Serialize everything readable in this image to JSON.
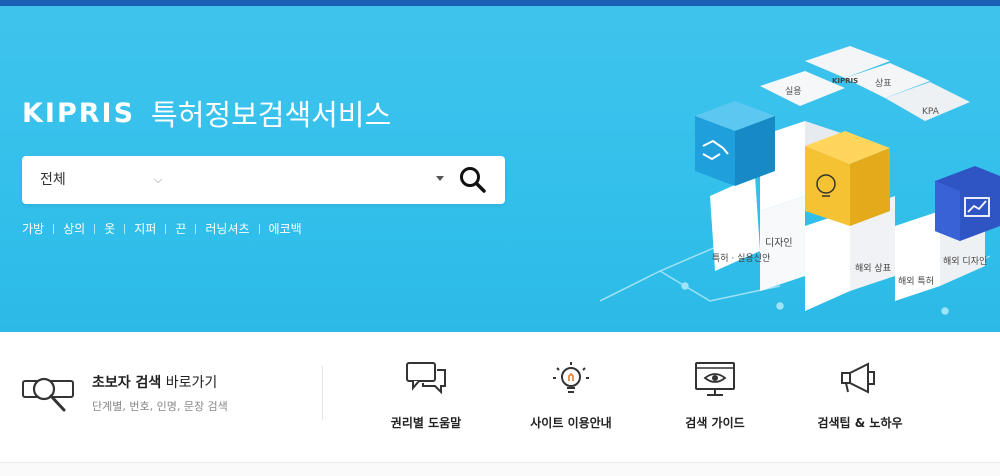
{
  "header": {
    "logo_text": "KIPRIS",
    "service_title": "특허정보검색서비스"
  },
  "search": {
    "scope_selected": "전체",
    "query": "",
    "scope_chevron_icon": "chevron-down-icon",
    "button_icon": "search-icon"
  },
  "keywords": [
    "가방",
    "상의",
    "옷",
    "지퍼",
    "끈",
    "러닝셔츠",
    "에코백"
  ],
  "cube": {
    "faces": [
      "실용",
      "KIPRIS",
      "상표",
      "KPA",
      "디자인",
      "특허 · 실용신안",
      "해외 상표",
      "해외 특허",
      "해외 디자인"
    ]
  },
  "quick": {
    "beginner_bold": "초보자 검색",
    "beginner_rest": " 바로가기",
    "beginner_sub": "단계별, 번호, 인명, 문장 검색",
    "items": [
      {
        "label": "권리별 도움말",
        "icon": "speech-bubbles-icon"
      },
      {
        "label": "사이트 이용안내",
        "icon": "lightbulb-icon"
      },
      {
        "label": "검색 가이드",
        "icon": "monitor-eye-icon"
      },
      {
        "label": "검색팁 & 노하우",
        "icon": "megaphone-icon"
      }
    ]
  },
  "colors": {
    "hero_bg": "#36c1ec",
    "top_bar": "#1a5fb4",
    "cube_blue": "#1f9fdc",
    "cube_yellow": "#f5c233",
    "cube_navy": "#2f55c4"
  }
}
